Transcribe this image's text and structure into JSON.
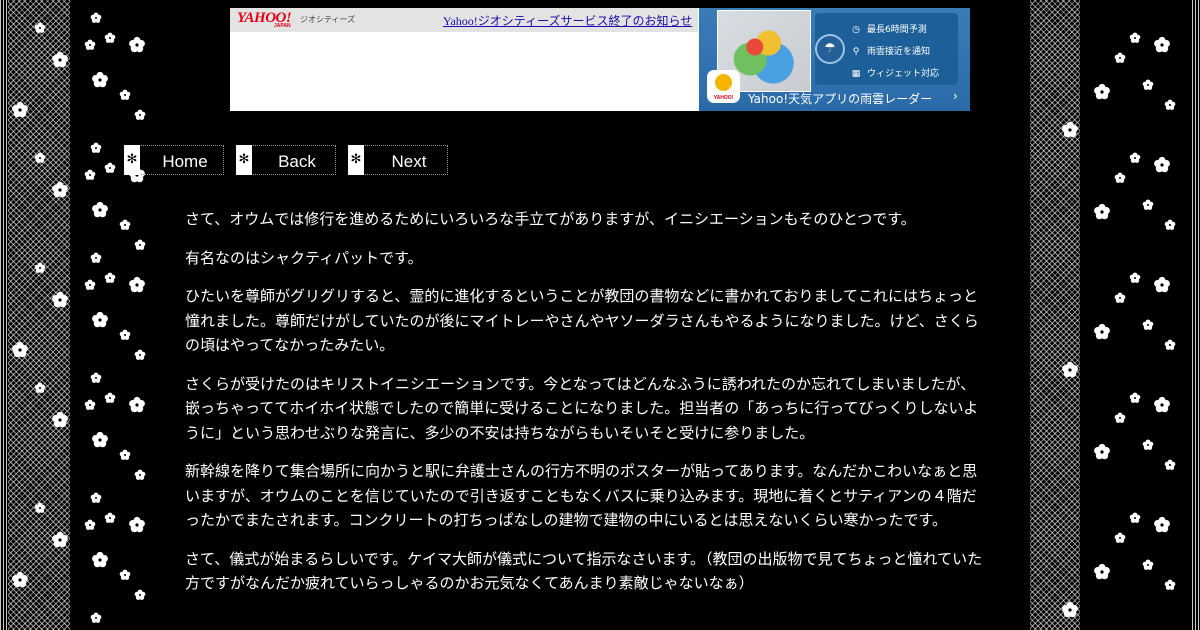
{
  "ad": {
    "logo_text": "YAHOO!",
    "logo_sub": "JAPAN",
    "geocities_label": "ジオシティーズ",
    "notice_link": "Yahoo!ジオシティーズサービス終了のお知らせ",
    "weather": {
      "features": [
        {
          "icon": "clock-icon",
          "glyph": "◷",
          "label": "最長6時間予測"
        },
        {
          "icon": "pin-icon",
          "glyph": "⚲",
          "label": "雨雲接近を通知"
        },
        {
          "icon": "widget-icon",
          "glyph": "▦",
          "label": "ウィジェット対応"
        }
      ],
      "app_icon_label": "YAHOO!",
      "cta": "Yahoo!天気アプリの雨雲レーダー",
      "chevron": "›"
    }
  },
  "nav": {
    "home": "Home",
    "back": "Back",
    "next": "Next",
    "tab_glyph": "✻"
  },
  "article": {
    "paragraphs": [
      "さて、オウムでは修行を進めるためにいろいろな手立てがありますが、イニシエーションもそのひとつです。",
      "有名なのはシャクティパットです。",
      "ひたいを尊師がグリグリすると、霊的に進化するということが教団の書物などに書かれておりましてこれにはちょっと憧れました。尊師だけがしていたのが後にマイトレーやさんやヤソーダラさんもやるようになりました。けど、さくらの頃はやってなかったみたい。",
      "さくらが受けたのはキリストイニシエーションです。今となってはどんなふうに誘われたのか忘れてしまいましたが、嵌っちゃっててホイホイ状態でしたので簡単に受けることになりました。担当者の「あっちに行ってびっくりしないように」という思わせぶりな発言に、多少の不安は持ちながらもいそいそと受けに参りました。",
      "新幹線を降りて集合場所に向かうと駅に弁護士さんの行方不明のポスターが貼ってあります。なんだかこわいなぁと思いますが、オウムのことを信じていたので引き返すこともなくバスに乗り込みます。現地に着くとサティアンの４階だったかでまたされます。コンクリートの打ちっぱなしの建物で建物の中にいるとは思えないくらい寒かったです。",
      "さて、儀式が始まるらしいです。ケイマ大師が儀式について指示なさいます。（教団の出版物で見てちょっと憧れていた方ですがなんだか疲れていらっしゃるのかお元気なくてあんまり素敵じゃないなぁ）"
    ]
  }
}
